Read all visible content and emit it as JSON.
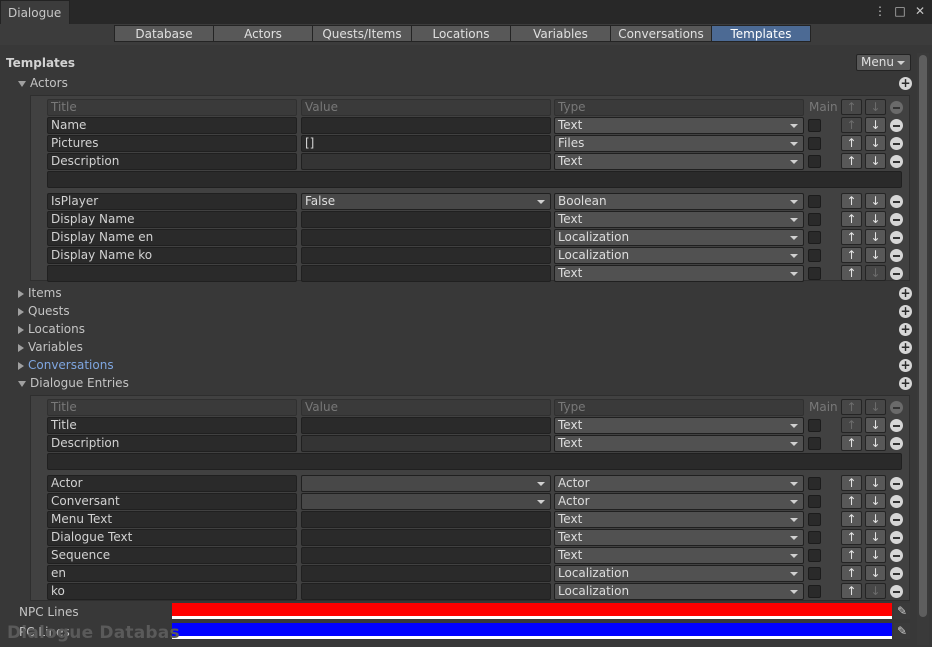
{
  "window": {
    "title": "Dialogue"
  },
  "tabs": [
    "Database",
    "Actors",
    "Quests/Items",
    "Locations",
    "Variables",
    "Conversations",
    "Templates"
  ],
  "active_tab": "Templates",
  "section": {
    "title": "Templates",
    "menu_label": "Menu"
  },
  "columns": {
    "title": "Title",
    "value": "Value",
    "type": "Type",
    "main": "Main"
  },
  "groups": {
    "actors": "Actors",
    "items": "Items",
    "quests": "Quests",
    "locations": "Locations",
    "variables": "Variables",
    "conversations": "Conversations",
    "dialogue_entries": "Dialogue Entries"
  },
  "actor_fields": [
    {
      "title": "Name",
      "value": "",
      "type": "Text"
    },
    {
      "title": "Pictures",
      "value": "[]",
      "type": "Files"
    },
    {
      "title": "Description",
      "value": "",
      "type": "Text"
    },
    {
      "title": "IsPlayer",
      "value": "False",
      "type": "Boolean"
    },
    {
      "title": "Display Name",
      "value": "",
      "type": "Text"
    },
    {
      "title": "Display Name en",
      "value": "",
      "type": "Localization"
    },
    {
      "title": "Display Name ko",
      "value": "",
      "type": "Localization"
    },
    {
      "title": "",
      "value": "",
      "type": "Text"
    }
  ],
  "dialogue_fields": [
    {
      "title": "Title",
      "value": "",
      "type": "Text"
    },
    {
      "title": "Description",
      "value": "",
      "type": "Text"
    },
    {
      "title": "Actor",
      "value": "",
      "type": "Actor"
    },
    {
      "title": "Conversant",
      "value": "",
      "type": "Actor"
    },
    {
      "title": "Menu Text",
      "value": "",
      "type": "Text"
    },
    {
      "title": "Dialogue Text",
      "value": "",
      "type": "Text"
    },
    {
      "title": "Sequence",
      "value": "",
      "type": "Text"
    },
    {
      "title": "en",
      "value": "",
      "type": "Localization"
    },
    {
      "title": "ko",
      "value": "",
      "type": "Localization"
    }
  ],
  "colors": {
    "npc_label": "NPC Lines",
    "npc_color": "#ff0000",
    "pc_label": "PC Lines",
    "pc_color": "#0000ff"
  },
  "watermark": "Dialogue Databas"
}
